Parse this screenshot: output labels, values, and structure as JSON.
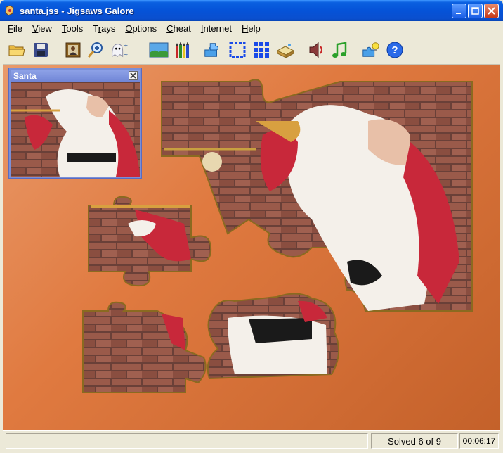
{
  "window": {
    "title": "santa.jss - Jigsaws Galore"
  },
  "menu": {
    "items": [
      {
        "label": "File",
        "key": "F",
        "rest": "ile"
      },
      {
        "label": "View",
        "key": "V",
        "rest": "iew"
      },
      {
        "label": "Tools",
        "key": "T",
        "rest": "ools"
      },
      {
        "label": "Trays",
        "key": "r",
        "pre": "T",
        "rest": "ays"
      },
      {
        "label": "Options",
        "key": "O",
        "rest": "ptions"
      },
      {
        "label": "Cheat",
        "key": "C",
        "rest": "heat"
      },
      {
        "label": "Internet",
        "key": "I",
        "rest": "nternet"
      },
      {
        "label": "Help",
        "key": "H",
        "rest": "elp"
      }
    ]
  },
  "toolbar": {
    "icons": [
      "open-folder-icon",
      "save-disk-icon",
      "picture-icon",
      "zoom-icon",
      "ghost-icon",
      "background-icon",
      "crayons-icon",
      "shuffle-icon",
      "edges-icon",
      "grid-icon",
      "book-icon",
      "sound-icon",
      "music-icon",
      "hint-icon",
      "help-icon"
    ]
  },
  "preview": {
    "title": "Santa"
  },
  "status": {
    "solved": "Solved 6 of 9",
    "timer": "00:06:17"
  },
  "colors": {
    "titlebar": "#0553d8",
    "background": "#e07a40",
    "brick": "#8a4a3a",
    "santa_red": "#c8283a"
  }
}
